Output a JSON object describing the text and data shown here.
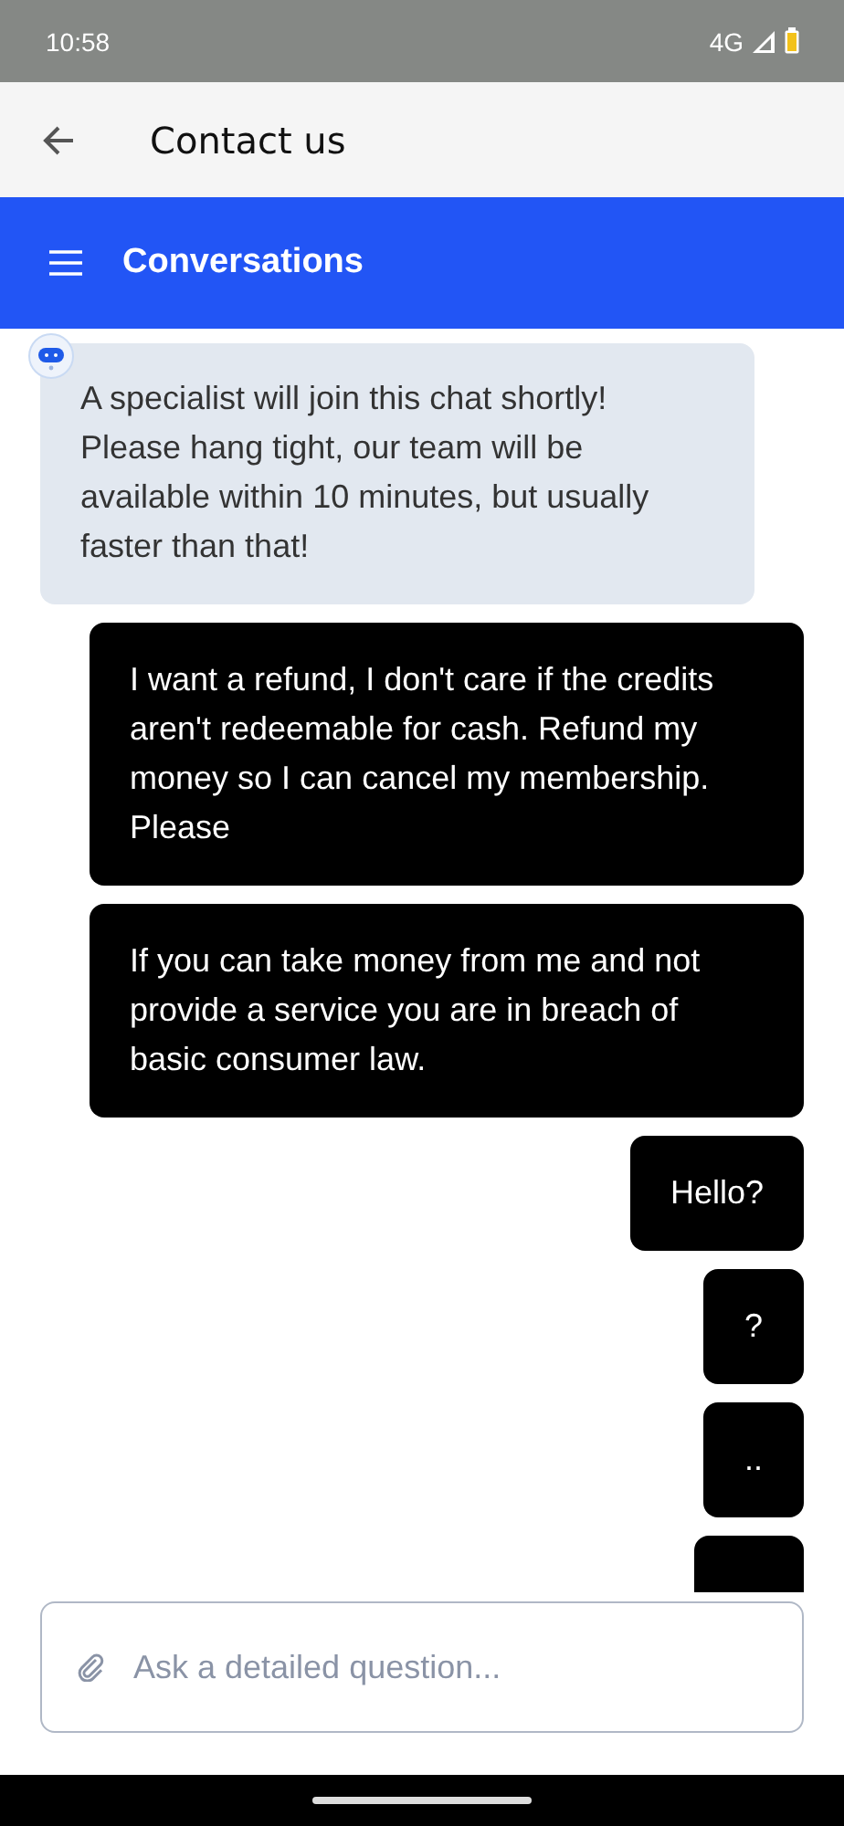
{
  "status_bar": {
    "time": "10:58",
    "network": "4G"
  },
  "app_bar": {
    "title": "Contact us"
  },
  "header": {
    "title": "Conversations"
  },
  "messages": [
    {
      "kind": "agent",
      "text": "A specialist will join this chat shortly! Please hang tight, our team will be available within 10 minutes, but usually faster than that!"
    },
    {
      "kind": "user",
      "text": "I want a refund, I don't care if the credits aren't redeemable for cash. Refund my money so I can cancel my membership. Please"
    },
    {
      "kind": "user",
      "text": "If you can take money from me and not provide a service you are in breach of basic consumer law."
    },
    {
      "kind": "user",
      "text": "Hello?"
    },
    {
      "kind": "user",
      "text": "?"
    },
    {
      "kind": "user",
      "text": ".."
    },
    {
      "kind": "partial"
    }
  ],
  "composer": {
    "placeholder": "Ask a detailed question..."
  }
}
